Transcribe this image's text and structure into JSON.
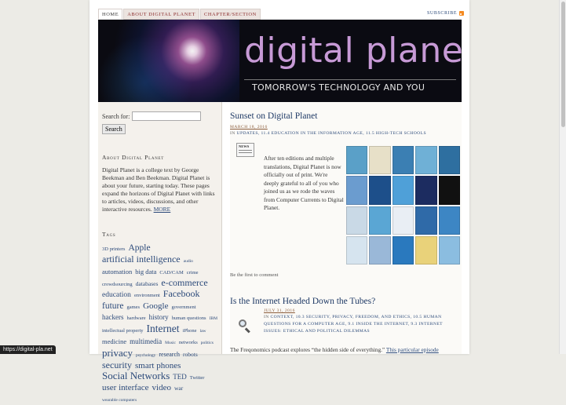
{
  "nav": {
    "tabs": [
      "HOME",
      "ABOUT DIGITAL PLANET",
      "CHAPTER/SECTION"
    ],
    "subscribe_label": "SUBSCRIBE"
  },
  "banner": {
    "title": "digital planet",
    "subtitle": "TOMORROW'S TECHNOLOGY AND YOU"
  },
  "sidebar": {
    "search_label": "Search for:",
    "search_value": "",
    "search_button": "Search",
    "about_heading": "About Digital Planet",
    "about_text": "Digital Planet is a college text by George Beekman and Ben Beekman. Digital Planet is about your future, starting today. These pages expand the horizons of Digital Planet with links to articles, videos, discussions, and other interactive resources.",
    "about_more": "MORE",
    "tags_heading": "Tags",
    "tags": [
      {
        "text": "3D printers",
        "size": 6.5
      },
      {
        "text": "Apple",
        "size": 11.5
      },
      {
        "text": "artificial intelligence",
        "size": 12
      },
      {
        "text": "audio",
        "size": 5.5
      },
      {
        "text": "automation",
        "size": 8.5
      },
      {
        "text": "big data",
        "size": 8.5
      },
      {
        "text": "CAD/CAM",
        "size": 6.5
      },
      {
        "text": "crime",
        "size": 6.5
      },
      {
        "text": "crowdsourcing",
        "size": 6.5
      },
      {
        "text": "databases",
        "size": 7.5
      },
      {
        "text": "e-commerce",
        "size": 12
      },
      {
        "text": "education",
        "size": 9.5
      },
      {
        "text": "environment",
        "size": 6.5
      },
      {
        "text": "Facebook",
        "size": 12
      },
      {
        "text": "future",
        "size": 11.5
      },
      {
        "text": "games",
        "size": 6.5
      },
      {
        "text": "Google",
        "size": 11
      },
      {
        "text": "government",
        "size": 6.5
      },
      {
        "text": "hackers",
        "size": 9
      },
      {
        "text": "hardware",
        "size": 6.5
      },
      {
        "text": "history",
        "size": 9
      },
      {
        "text": "human questions",
        "size": 6.5
      },
      {
        "text": "IBM",
        "size": 5.5
      },
      {
        "text": "intellectual property",
        "size": 6.5
      },
      {
        "text": "Internet",
        "size": 13.5
      },
      {
        "text": "iPhone",
        "size": 6.5
      },
      {
        "text": "law",
        "size": 5.5
      },
      {
        "text": "medicine",
        "size": 8.5
      },
      {
        "text": "multimedia",
        "size": 9
      },
      {
        "text": "Music",
        "size": 5.5
      },
      {
        "text": "networks",
        "size": 6.5
      },
      {
        "text": "politics",
        "size": 5.5
      },
      {
        "text": "privacy",
        "size": 13
      },
      {
        "text": "psychology",
        "size": 5.5
      },
      {
        "text": "research",
        "size": 8
      },
      {
        "text": "robots",
        "size": 7.5
      },
      {
        "text": "security",
        "size": 12
      },
      {
        "text": "smart phones",
        "size": 11
      },
      {
        "text": "Social Networks",
        "size": 13
      },
      {
        "text": "TED",
        "size": 9
      },
      {
        "text": "Twitter",
        "size": 6.5
      },
      {
        "text": "user interface",
        "size": 11
      },
      {
        "text": "video",
        "size": 11
      },
      {
        "text": "war",
        "size": 7.5
      },
      {
        "text": "wearable computers",
        "size": 5.5
      }
    ]
  },
  "posts": [
    {
      "title": "Sunset on Digital Planet",
      "date": "MARCH 18, 2016",
      "categories_prefix": "IN",
      "categories": "UPDATES, 11.4 EDUCATION IN THE INFORMATION AGE, 11.5 HIGH-TECH SCHOOLS",
      "icon_text": "NEWS",
      "body": "After ten editions and multiple translations, Digital Planet is now officially out of print. We're deeply grateful to all of you who joined us as we rode the waves from Computer Currents to Digital Planet.",
      "comment_link": "Be the first to comment"
    },
    {
      "title": "Is the Internet Headed Down the Tubes?",
      "date": "JULY 31, 2016",
      "categories_prefix": "IN",
      "categories": "CONTEXT, 10.3 SECURITY, PRIVACY, FREEDOM, AND ETHICS, 10.5 HUMAN QUESTIONS FOR A COMPUTER AGE, 9.1 INSIDE THE INTERNET, 9.3 INTERNET ISSUES: ETHICAL AND POLITICAL DILEMMAS",
      "body_start": "The Freqonomics podcast explores “the hidden side of everything.”",
      "body_link": "This particular episode"
    }
  ],
  "book_colors": [
    "#5aa0c8",
    "#e7e0c8",
    "#3b7fb3",
    "#6fb0d6",
    "#2e6fa0",
    "#6b9ccf",
    "#1d4f8a",
    "#4fa0d8",
    "#1c2c60",
    "#111111",
    "#c9d9e6",
    "#5aa6d4",
    "#e9eef4",
    "#2f6aa8",
    "#3d86c4",
    "#d6e4ef",
    "#9ab8d8",
    "#2a79be",
    "#e9d27a",
    "#8bbde0"
  ],
  "status_bar": "https://digital-pla.net"
}
